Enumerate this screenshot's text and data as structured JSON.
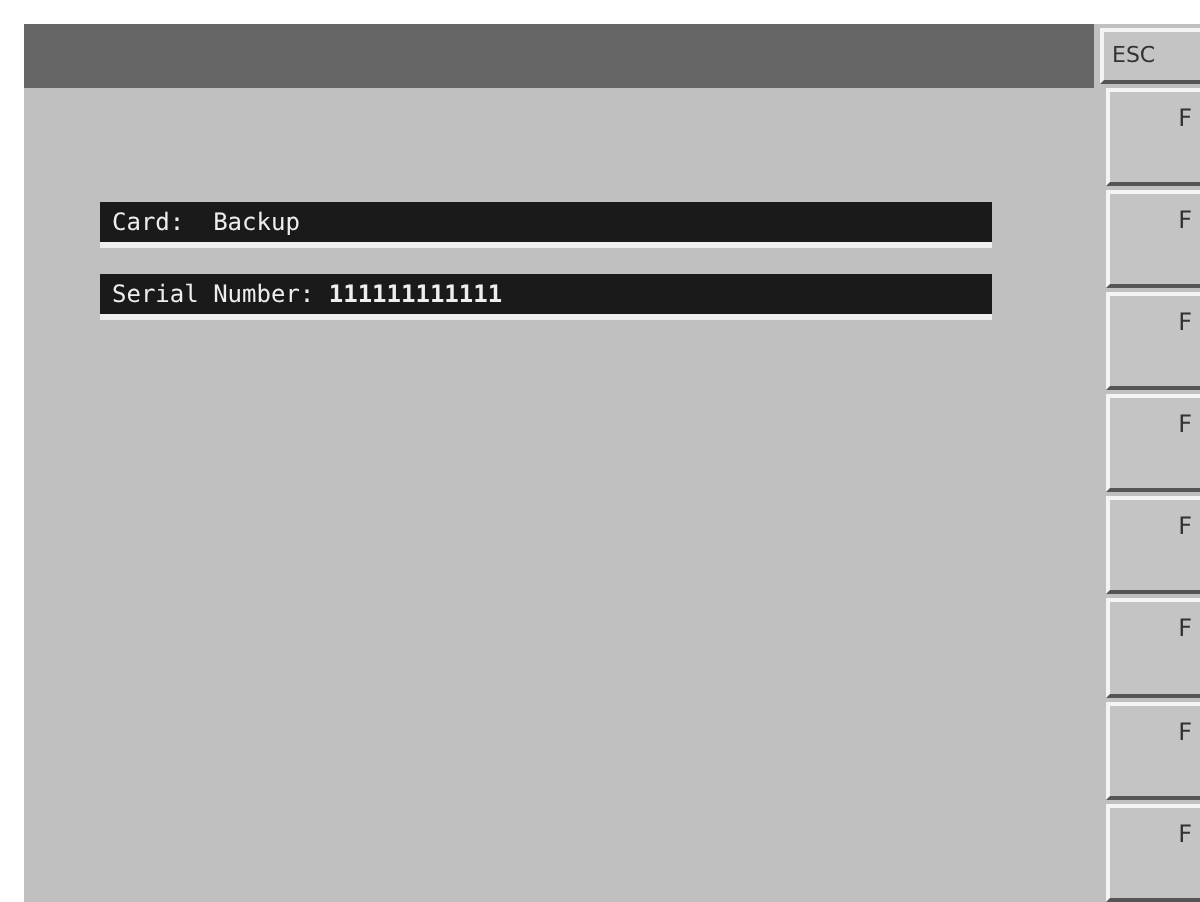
{
  "fields": [
    {
      "text": "Card:  Backup"
    },
    {
      "text": "Serial Number: **111111111111**"
    }
  ],
  "softkeys": [
    {
      "label": "ESC",
      "kind": "escape"
    },
    {
      "label": "F",
      "kind": "function"
    },
    {
      "label": "F",
      "kind": "function"
    },
    {
      "label": "F",
      "kind": "function"
    },
    {
      "label": "F",
      "kind": "function"
    },
    {
      "label": "F",
      "kind": "function"
    },
    {
      "label": "F",
      "kind": "function"
    },
    {
      "label": "F",
      "kind": "function"
    },
    {
      "label": "F",
      "kind": "function"
    }
  ]
}
